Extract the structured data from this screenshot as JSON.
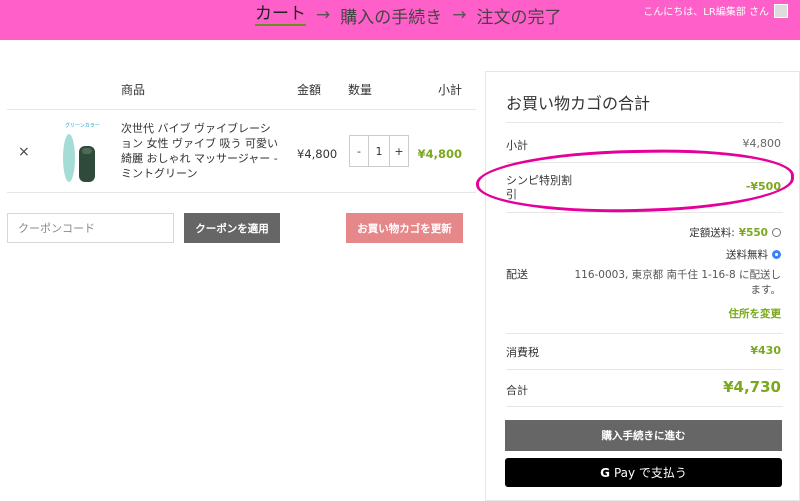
{
  "header": {
    "steps": [
      "カート",
      "購入の手続き",
      "注文の完了"
    ],
    "arrow": "→",
    "greeting": "こんにちは、LR編集部 さん"
  },
  "cart_table": {
    "headers": {
      "product": "商品",
      "price": "金額",
      "qty": "数量",
      "subtotal": "小計"
    },
    "items": [
      {
        "remove": "×",
        "thumb_label": "グリーンカラー",
        "name": "次世代 バイブ ヴァイブレーション 女性 ヴァイブ 吸う 可愛い 綺麗 おしゃれ マッサージャー - ミントグリーン",
        "price": "¥4,800",
        "qty_minus": "-",
        "qty": "1",
        "qty_plus": "+",
        "subtotal": "¥4,800"
      }
    ]
  },
  "coupon": {
    "placeholder": "クーポンコード",
    "apply_label": "クーポンを適用",
    "update_label": "お買い物カゴを更新"
  },
  "totals": {
    "title": "お買い物カゴの合計",
    "subtotal_label": "小計",
    "subtotal_value": "¥4,800",
    "discount_label_1": "シンピ特別割",
    "discount_label_2": "引",
    "discount_value": "-¥500",
    "shipping_label": "配送",
    "shipping_opt1_label": "定額送料:",
    "shipping_opt1_price": "¥550",
    "shipping_opt2_label": "送料無料",
    "shipping_selected": "送料無料",
    "address_line1": "116-0003, 東京都 南千住 1-16-8 に配送し",
    "address_line2": "ます。",
    "change_address": "住所を変更",
    "tax_label": "消費税",
    "tax_value": "¥430",
    "total_label": "合計",
    "total_value": "¥4,730",
    "checkout_label": "購入手続きに進む",
    "gpay_label": "Pay で支払う",
    "gpay_g": "G"
  },
  "colors": {
    "header_bg": "#ff5fc8",
    "accent_green": "#7aa81e",
    "annotation_magenta": "#e4009a",
    "update_button": "#e6888a"
  }
}
